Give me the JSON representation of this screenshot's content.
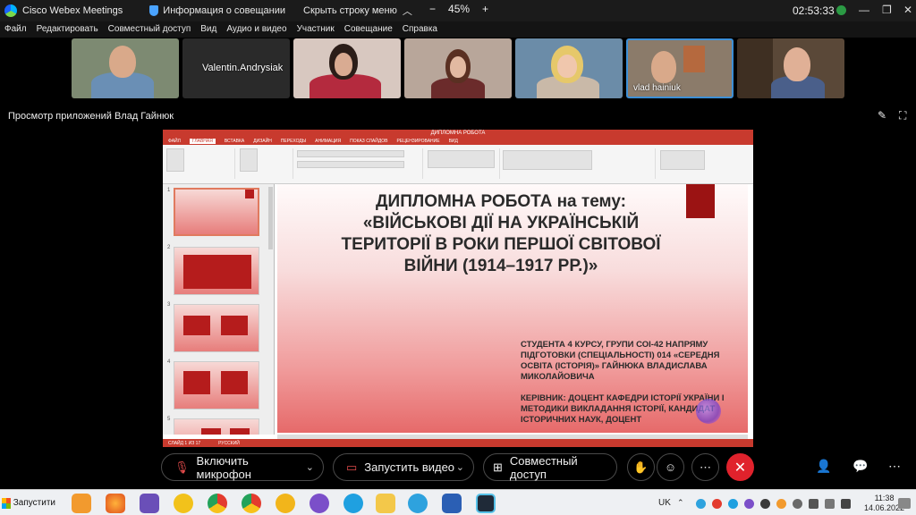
{
  "titlebar": {
    "app_name": "Cisco Webex Meetings",
    "meeting_info": "Информация о совещании",
    "hide_menu": "Скрыть строку меню",
    "timer": "02:53:33"
  },
  "menu": [
    "Файл",
    "Редактировать",
    "Совместный доступ",
    "Вид",
    "Аудио и видео",
    "Участник",
    "Совещание",
    "Справка"
  ],
  "participants": [
    {
      "name": "",
      "bg": "#7d8a72"
    },
    {
      "name": "Valentin.Andrysiak",
      "bg": "#2a2a2a"
    },
    {
      "name": "",
      "bg": "#d8c8c0"
    },
    {
      "name": "",
      "bg": "#b8a69a"
    },
    {
      "name": "",
      "bg": "#6b8ca8"
    },
    {
      "name": "vlad hainiuk",
      "bg": "#8b7b6a"
    },
    {
      "name": "",
      "bg": "#5a4838"
    }
  ],
  "share": {
    "title": "Просмотр приложений Влад Гайнюк",
    "zoom_minus": "−",
    "zoom_level": "45%",
    "zoom_plus": "+"
  },
  "ppt": {
    "window_title": "ДИПЛОМНА РОБОТА",
    "tabs": [
      "ФАЙЛ",
      "ГЛАВНАЯ",
      "ВСТАВКА",
      "ДИЗАЙН",
      "ПЕРЕХОДЫ",
      "АНИМАЦИЯ",
      "ПОКАЗ СЛАЙДОВ",
      "РЕЦЕНЗИРОВАНИЕ",
      "ВИД"
    ],
    "slide_numbers": [
      "1",
      "2",
      "3",
      "4",
      "5"
    ],
    "status_left": "СЛАЙД 1 ИЗ 17",
    "status_lang": "РУССКИЙ"
  },
  "slide": {
    "title": "ДИПЛОМНА РОБОТА на тему: «ВІЙСЬКОВІ ДІЇ НА УКРАЇНСЬКІЙ ТЕРИТОРІЇ В РОКИ ПЕРШОЇ СВІТОВОЇ ВІЙНИ (1914–1917 РР.)»",
    "author": "СТУДЕНТА 4 КУРСУ, ГРУПИ СОІ-42 НАПРЯМУ ПІДГОТОВКИ (СПЕЦІАЛЬНОСТІ) 014 «СЕРЕДНЯ ОСВІТА (ІСТОРІЯ)» ГАЙНЮКА ВЛАДИСЛАВА МИКОЛАЙОВИЧА",
    "supervisor": "КЕРІВНИК: ДОЦЕНТ КАФЕДРИ ІСТОРІЇ УКРАЇНИ І МЕТОДИКИ ВИКЛАДАННЯ ІСТОРІЇ, КАНДИДАТ ІСТОРИЧНИХ НАУК, ДОЦЕНТ"
  },
  "controls": {
    "mic": "Включить микрофон",
    "video": "Запустить видео",
    "share": "Совместный доступ"
  },
  "taskbar": {
    "start": "Запустити",
    "lang": "UK",
    "time": "11:38",
    "date": "14.06.2022"
  }
}
